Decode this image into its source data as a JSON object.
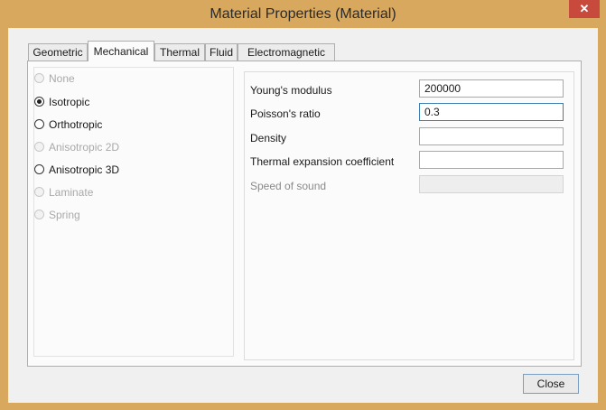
{
  "window": {
    "title": "Material Properties (Material)",
    "close_glyph": "✕",
    "frame_color": "#d7a85d"
  },
  "tabs": [
    {
      "label": "Geometric",
      "active": false
    },
    {
      "label": "Mechanical",
      "active": true
    },
    {
      "label": "Thermal",
      "active": false
    },
    {
      "label": "Fluid",
      "active": false
    },
    {
      "label": "Electromagnetic",
      "active": false
    }
  ],
  "material_types": [
    {
      "label": "None",
      "checked": false,
      "enabled": false
    },
    {
      "label": "Isotropic",
      "checked": true,
      "enabled": true
    },
    {
      "label": "Orthotropic",
      "checked": false,
      "enabled": true
    },
    {
      "label": "Anisotropic 2D",
      "checked": false,
      "enabled": false
    },
    {
      "label": "Anisotropic 3D",
      "checked": false,
      "enabled": true
    },
    {
      "label": "Laminate",
      "checked": false,
      "enabled": false
    },
    {
      "label": "Spring",
      "checked": false,
      "enabled": false
    }
  ],
  "properties": [
    {
      "label": "Young's modulus",
      "value": "200000",
      "enabled": true
    },
    {
      "label": "Poisson's ratio",
      "value": "0.3",
      "enabled": true,
      "focused": true
    },
    {
      "label": "Density",
      "value": "",
      "enabled": true
    },
    {
      "label": "Thermal expansion coefficient",
      "value": "",
      "enabled": true
    },
    {
      "label": "Speed of sound",
      "value": "",
      "enabled": false
    }
  ],
  "buttons": {
    "close_label": "Close"
  }
}
